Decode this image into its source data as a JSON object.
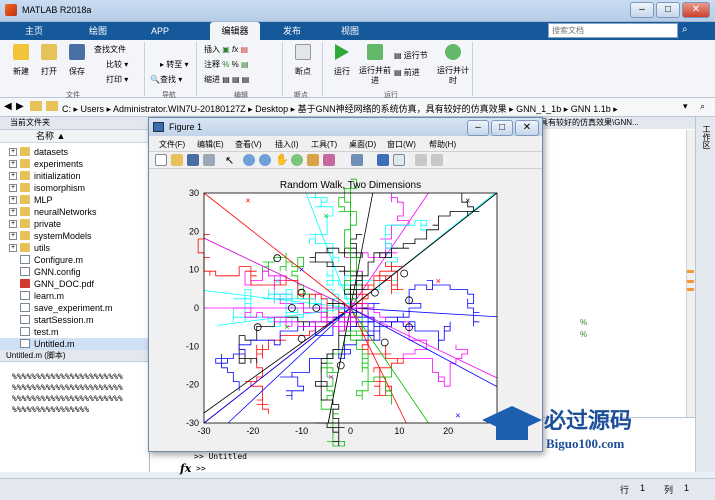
{
  "window": {
    "title": "MATLAB R2018a"
  },
  "tabs": [
    "主页",
    "绘图",
    "APP",
    "编辑器",
    "发布",
    "视图"
  ],
  "search": {
    "placeholder": "搜索文档"
  },
  "ribbon": {
    "file": {
      "new": "新建",
      "open": "打开",
      "save": "保存",
      "find_files": "查找文件",
      "compare": "比较",
      "print": "打印",
      "label": "文件"
    },
    "nav": {
      "goto": "转至",
      "find": "查找",
      "label": "导航"
    },
    "edit": {
      "insert": "插入",
      "comment": "注释",
      "indent": "缩进",
      "label": "编辑"
    },
    "breakpoints": {
      "bp": "断点",
      "label": "断点"
    },
    "run": {
      "run": "运行",
      "run_advance": "运行并前进",
      "run_section": "运行节",
      "advance": "前进",
      "run_time": "运行并计时",
      "label": "运行"
    }
  },
  "path": {
    "segments": "C: ▸ Users ▸ Administrator.WIN7U-20180127Z ▸ Desktop ▸ 基于GNN神经网络的系统仿真，具有较好的仿真效果 ▸ GNN_1_1b ▸ GNN 1.1b ▸"
  },
  "browser": {
    "header": "当前文件夹",
    "column": "名称 ▲",
    "folders": [
      "datasets",
      "experiments",
      "initialization",
      "isomorphism",
      "MLP",
      "neuralNetworks",
      "private",
      "systemModels",
      "utils"
    ],
    "files": [
      "Configure.m",
      "GNN.config",
      "GNN_DOC.pdf",
      "learn.m",
      "save_experiment.m",
      "startSession.m",
      "test.m",
      "Untitled.m"
    ]
  },
  "editor": {
    "tabtext": "具有较好的仿真效果\\GNN...",
    "markers": [
      "%",
      "%"
    ]
  },
  "detail": {
    "header": "Untitled.m (脚本)",
    "lines": [
      "%%%%%%%%%%%%%%%%%%%%%%%",
      "%%%%%%%%%%%%%%%%%%%%%%%",
      "%%%%%%%%%%%%%%%%%%%%%%%",
      "%%%%%%%%%%%%%%%%"
    ]
  },
  "command": {
    "prompt": ">> Untitled",
    "fx": "fx",
    "prompt2": ">>"
  },
  "status": {
    "row_label": "行",
    "row": "1",
    "col_label": "列",
    "col": "1"
  },
  "rightpanel": {
    "label": "工作区"
  },
  "figure": {
    "title": "Figure 1",
    "menus": [
      "文件(F)",
      "编辑(E)",
      "查看(V)",
      "插入(I)",
      "工具(T)",
      "桌面(D)",
      "窗口(W)",
      "帮助(H)"
    ]
  },
  "watermark": {
    "brand": "必过源码",
    "url": "Biguo100.com"
  },
  "chart_data": {
    "type": "line",
    "title": "Random Walk, Two Dimensions",
    "xlim": [
      -30,
      30
    ],
    "ylim": [
      -30,
      30
    ],
    "xticks": [
      -30,
      -20,
      -10,
      0,
      10,
      20
    ],
    "yticks": [
      30,
      20,
      10,
      0,
      -10,
      -20,
      -30
    ],
    "start_point": [
      0,
      0
    ],
    "series_colors": [
      "#ff0000",
      "#00c000",
      "#0000ff",
      "#00ffff",
      "#ff00ff",
      "#000000"
    ],
    "circle_endpoints": [
      [
        -15,
        13
      ],
      [
        -10,
        4
      ],
      [
        -7,
        0
      ],
      [
        -19,
        -5
      ],
      [
        -10,
        -8
      ],
      [
        5,
        4
      ],
      [
        11,
        9
      ],
      [
        12,
        2
      ],
      [
        12,
        -5
      ],
      [
        -2,
        -15
      ],
      [
        7,
        -9
      ],
      [
        -12,
        0
      ]
    ],
    "cross_endpoints": [
      [
        -21,
        28
      ],
      [
        -5,
        24
      ],
      [
        -10,
        10
      ],
      [
        -15,
        7
      ],
      [
        -4,
        -18
      ],
      [
        24,
        28
      ],
      [
        18,
        7
      ],
      [
        -13,
        -5
      ],
      [
        22,
        -28
      ]
    ]
  }
}
